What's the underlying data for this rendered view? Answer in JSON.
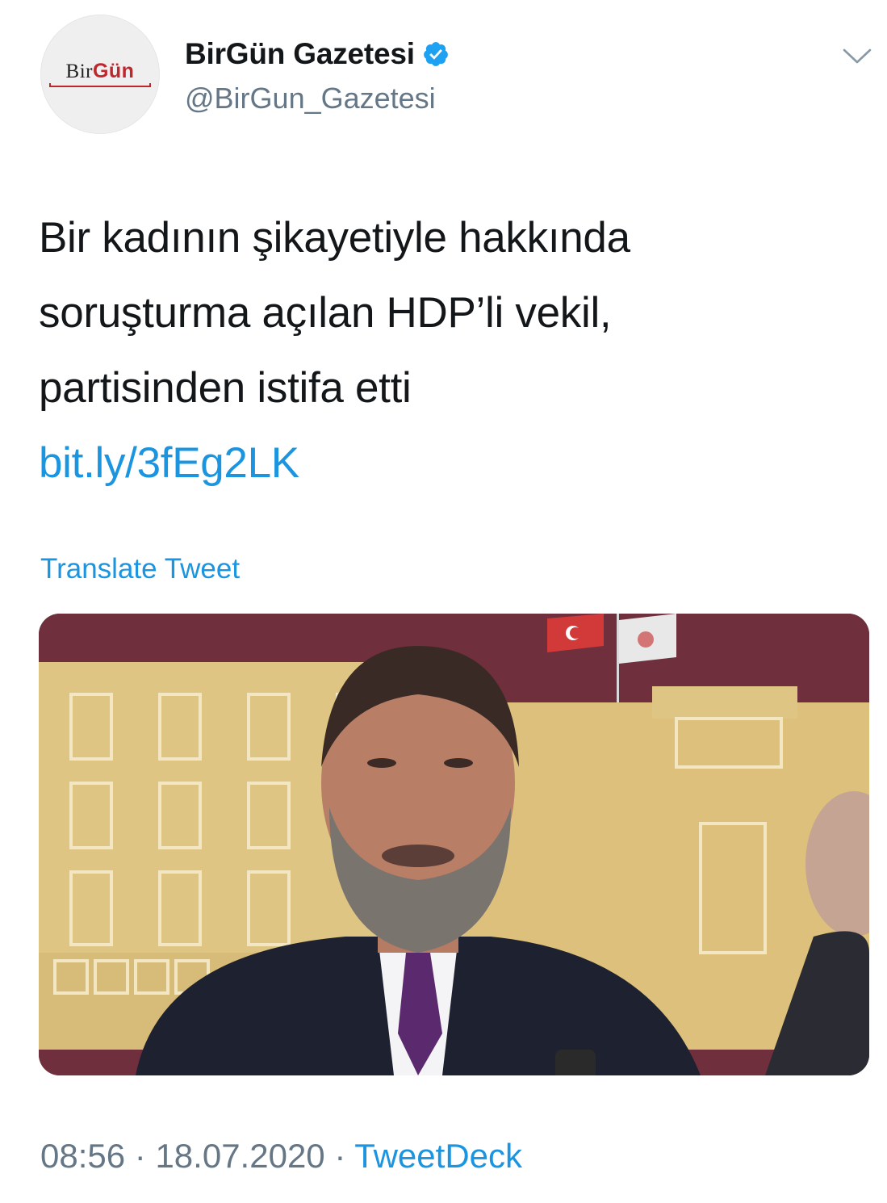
{
  "author": {
    "display_name": "BirGün Gazetesi",
    "handle": "@BirGun_Gazetesi",
    "verified": true,
    "avatar_logo": {
      "part1": "Bir",
      "part2": "Gün"
    }
  },
  "tweet": {
    "lines": [
      "Bir kadının şikayetiyle hakkında",
      "soruşturma açılan HDP’li vekil,",
      "partisinden istifa etti"
    ],
    "link": "bit.ly/3fEg2LK",
    "translate_label": "Translate Tweet"
  },
  "media": {
    "type": "photo"
  },
  "meta": {
    "time": "08:56",
    "separator": "·",
    "date": "18.07.2020",
    "source": "TweetDeck"
  },
  "icons": {
    "verified": "verified-badge-icon",
    "menu": "chevron-down-icon"
  },
  "colors": {
    "link": "#1b95e0",
    "secondary_text": "#657786",
    "primary_text": "#14171a",
    "brand_red": "#c0272d"
  }
}
